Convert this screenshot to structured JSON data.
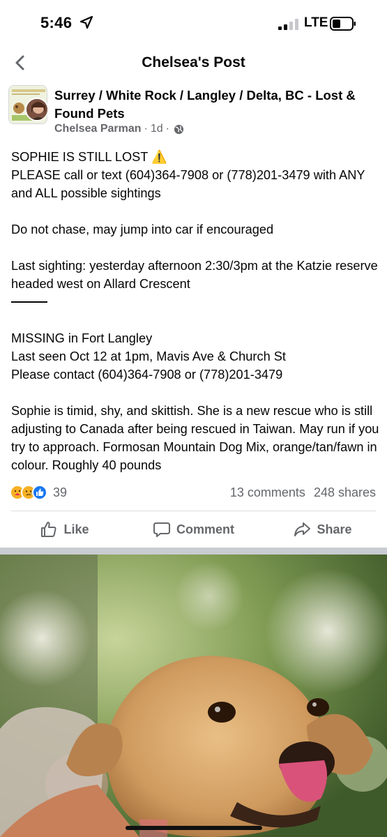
{
  "status_bar": {
    "time": "5:46",
    "network": "LTE",
    "icons": [
      "location-arrow-icon",
      "signal-bars-icon",
      "battery-icon"
    ]
  },
  "nav": {
    "title": "Chelsea's Post",
    "back_icon": "chevron-left-icon"
  },
  "post": {
    "group_name": "Surrey / White Rock  / Langley / Delta, BC - Lost & Found Pets",
    "author": "Chelsea Parman",
    "time": "1d",
    "separator": "·",
    "privacy_icon": "globe-icon",
    "body": {
      "line1": "SOPHIE IS STILL LOST ⚠️",
      "line2": "PLEASE call or text (604)364-7908 or (778)201-3479 with ANY and ALL possible sightings",
      "line3": "Do not chase, may jump into car if encouraged",
      "line4": "Last sighting: yesterday afternoon 2:30/3pm at the Katzie reserve headed west on Allard Crescent",
      "line5": "MISSING in Fort Langley",
      "line6": "Last seen Oct 12 at 1pm, Mavis Ave & Church St",
      "line7": "Please contact (604)364-7908 or (778)201-3479",
      "line8": "Sophie is timid, shy, and skittish. She is a new rescue who is still adjusting to Canada after being rescued in Taiwan. May run if you try to approach. Formosan Mountain Dog Mix, orange/tan/fawn in colour. Roughly 40 pounds"
    },
    "reactions": {
      "icons": [
        "care-emoji-icon",
        "sad-emoji-icon",
        "like-thumb-icon"
      ],
      "count": "39",
      "comments": "13 comments",
      "shares": "248 shares"
    },
    "actions": {
      "like": "Like",
      "comment": "Comment",
      "share": "Share"
    }
  },
  "colors": {
    "text_primary": "#050505",
    "text_secondary": "#65676b",
    "like_blue": "#1877f2",
    "divider": "#dadde1"
  }
}
